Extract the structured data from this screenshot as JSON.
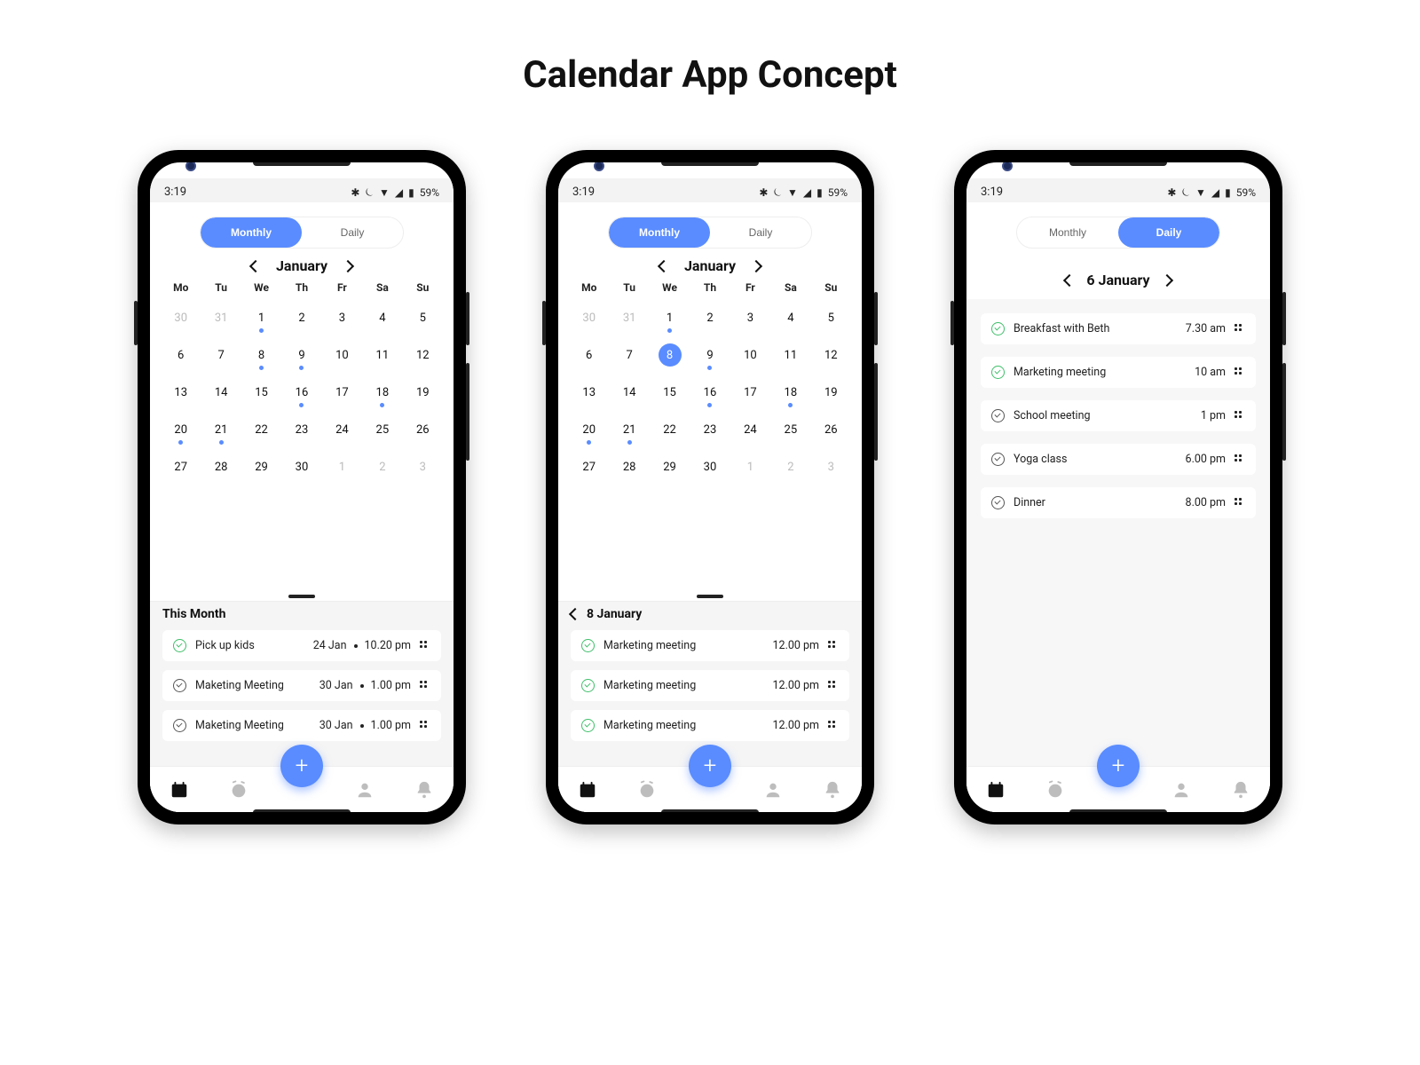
{
  "page": {
    "title": "Calendar App Concept"
  },
  "status": {
    "time": "3:19",
    "battery_label": "59%"
  },
  "segments": {
    "monthly": "Monthly",
    "daily": "Daily"
  },
  "month": {
    "label": "January",
    "dow": [
      "Mo",
      "Tu",
      "We",
      "Th",
      "Fr",
      "Sa",
      "Su"
    ],
    "cells": [
      {
        "n": 30,
        "muted": true
      },
      {
        "n": 31,
        "muted": true
      },
      {
        "n": 1,
        "dot": true
      },
      {
        "n": 2
      },
      {
        "n": 3
      },
      {
        "n": 4
      },
      {
        "n": 5
      },
      {
        "n": 6
      },
      {
        "n": 7
      },
      {
        "n": 8,
        "dot": true
      },
      {
        "n": 9,
        "dot": true
      },
      {
        "n": 10
      },
      {
        "n": 11
      },
      {
        "n": 12
      },
      {
        "n": 13
      },
      {
        "n": 14
      },
      {
        "n": 15
      },
      {
        "n": 16,
        "dot": true
      },
      {
        "n": 17
      },
      {
        "n": 18,
        "dot": true
      },
      {
        "n": 19
      },
      {
        "n": 20,
        "dot": true
      },
      {
        "n": 21,
        "dot": true
      },
      {
        "n": 22
      },
      {
        "n": 23
      },
      {
        "n": 24
      },
      {
        "n": 25
      },
      {
        "n": 26
      },
      {
        "n": 27
      },
      {
        "n": 28
      },
      {
        "n": 29
      },
      {
        "n": 30
      },
      {
        "n": 1,
        "muted": true
      },
      {
        "n": 2,
        "muted": true
      },
      {
        "n": 3,
        "muted": true
      }
    ]
  },
  "screen1": {
    "sheet_title": "This Month",
    "events": [
      {
        "done": "green",
        "title": "Pick up kids",
        "date": "24 Jan",
        "time": "10.20 pm"
      },
      {
        "done": "gray",
        "title": "Maketing Meeting",
        "date": "30 Jan",
        "time": "1.00 pm"
      },
      {
        "done": "gray",
        "title": "Maketing Meeting",
        "date": "30 Jan",
        "time": "1.00 pm"
      }
    ]
  },
  "screen2": {
    "selected_day": 8,
    "sheet_title": "8 January",
    "events": [
      {
        "done": "green",
        "title": "Marketing meeting",
        "time": "12.00 pm"
      },
      {
        "done": "green",
        "title": "Marketing meeting",
        "time": "12.00 pm"
      },
      {
        "done": "green",
        "title": "Marketing meeting",
        "time": "12.00 pm"
      }
    ]
  },
  "screen3": {
    "date_label": "6 January",
    "events": [
      {
        "done": "green",
        "title": "Breakfast with Beth",
        "time": "7.30 am"
      },
      {
        "done": "green",
        "title": "Marketing meeting",
        "time": "10 am"
      },
      {
        "done": "gray",
        "title": "School meeting",
        "time": "1 pm"
      },
      {
        "done": "gray",
        "title": "Yoga class",
        "time": "6.00 pm"
      },
      {
        "done": "gray",
        "title": "Dinner",
        "time": "8.00 pm"
      }
    ]
  }
}
